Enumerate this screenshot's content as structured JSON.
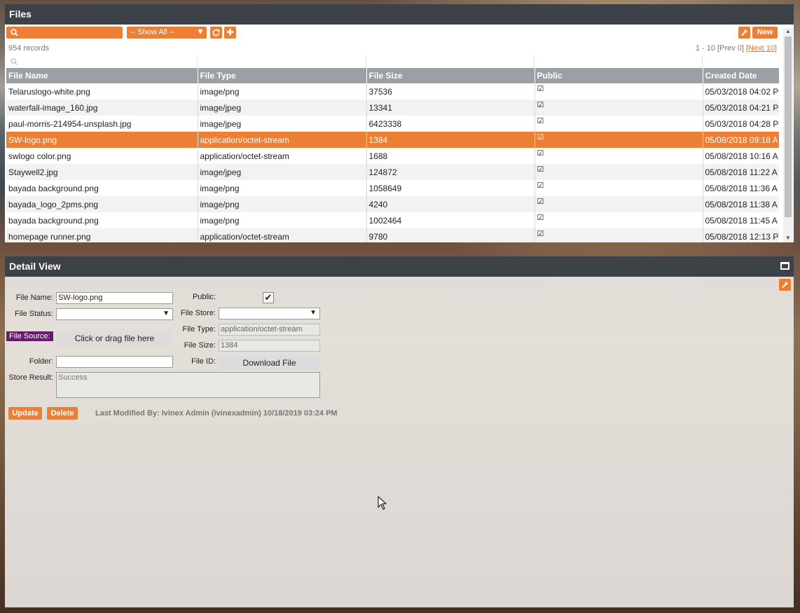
{
  "files_panel": {
    "title": "Files",
    "filter_select": "-- Show All --",
    "new_button": "New",
    "records_count": "954 records",
    "paging_prefix": "1 - 10 [Prev 0]",
    "paging_next": "[Next 10]",
    "columns": [
      "File Name",
      "File Type",
      "File Size",
      "Public",
      "Created Date"
    ],
    "rows": [
      {
        "name": "Telaruslogo-white.png",
        "type": "image/png",
        "size": "37536",
        "public": true,
        "created": "05/03/2018 04:02 P"
      },
      {
        "name": "waterfall-image_160.jpg",
        "type": "image/jpeg",
        "size": "13341",
        "public": true,
        "created": "05/03/2018 04:21 P"
      },
      {
        "name": "paul-morris-214954-unsplash.jpg",
        "type": "image/jpeg",
        "size": "6423338",
        "public": true,
        "created": "05/03/2018 04:28 P"
      },
      {
        "name": "SW-logo.png",
        "type": "application/octet-stream",
        "size": "1384",
        "public": true,
        "created": "05/08/2018 09:18 A",
        "selected": true
      },
      {
        "name": "swlogo color.png",
        "type": "application/octet-stream",
        "size": "1688",
        "public": true,
        "created": "05/08/2018 10:16 A"
      },
      {
        "name": "Staywell2.jpg",
        "type": "image/jpeg",
        "size": "124872",
        "public": true,
        "created": "05/08/2018 11:22 A"
      },
      {
        "name": "bayada background.png",
        "type": "image/png",
        "size": "1058649",
        "public": true,
        "created": "05/08/2018 11:36 A"
      },
      {
        "name": "bayada_logo_2pms.png",
        "type": "image/png",
        "size": "4240",
        "public": true,
        "created": "05/08/2018 11:38 A"
      },
      {
        "name": "bayada background.png",
        "type": "image/png",
        "size": "1002464",
        "public": true,
        "created": "05/08/2018 11:45 A"
      },
      {
        "name": "homepage runner.png",
        "type": "application/octet-stream",
        "size": "9780",
        "public": true,
        "created": "05/08/2018 12:13 P"
      }
    ]
  },
  "detail_panel": {
    "title": "Detail View",
    "labels": {
      "file_name": "File Name:",
      "file_status": "File Status:",
      "file_source": "File Source:",
      "folder": "Folder:",
      "store_result": "Store Result:",
      "public": "Public:",
      "file_store": "File Store:",
      "file_type": "File Type:",
      "file_size": "File Size:",
      "file_id": "File ID:"
    },
    "values": {
      "file_name": "SW-logo.png",
      "file_status": "",
      "folder": "",
      "store_result": "Success",
      "public_checked": true,
      "file_store": "",
      "file_type": "application/octet-stream",
      "file_size": "1384"
    },
    "drop_zone": "Click or drag file here",
    "download_button": "Download File",
    "update_button": "Update",
    "delete_button": "Delete",
    "last_modified": "Last Modified By: Ivinex Admin (ivinexadmin) 10/18/2019 03:24 PM"
  }
}
